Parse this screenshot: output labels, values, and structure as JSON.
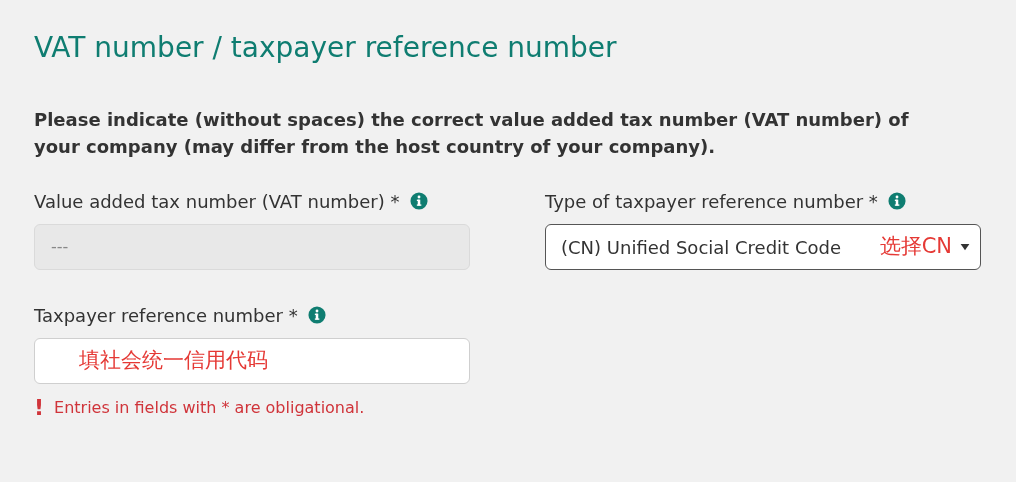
{
  "title": "VAT number / taxpayer reference number",
  "intro": "Please indicate (without spaces) the correct value added tax number (VAT number) of your company (may differ from the host country of your company).",
  "fields": [
    {
      "kind": "input",
      "label": "Value added tax number (VAT number) *",
      "placeholder": "---",
      "disabled": true
    },
    {
      "kind": "select",
      "label": "Type of taxpayer reference number *",
      "value": "(CN) Unified Social Credit Code",
      "note": "选择CN"
    },
    {
      "kind": "input",
      "label": "Taxpayer reference number *",
      "disabled": false,
      "note": "填社会统一信用代码"
    }
  ],
  "error": {
    "mark": "!",
    "text": "Entries in fields with * are obligational."
  }
}
